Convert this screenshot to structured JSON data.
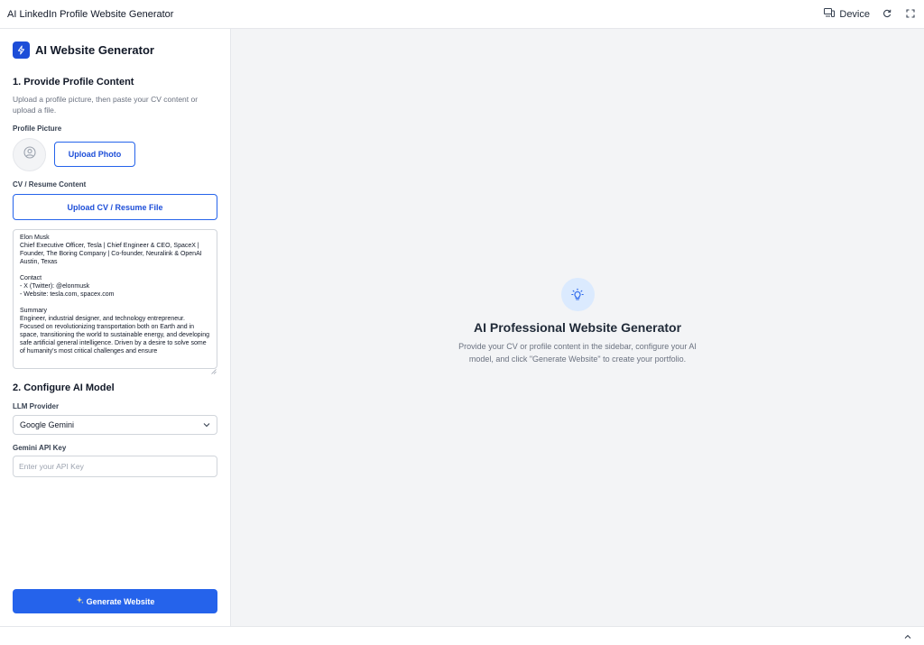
{
  "window": {
    "title": "AI LinkedIn Profile Website Generator",
    "device_label": "Device",
    "icons": {
      "device": "device-icon",
      "refresh": "refresh-icon",
      "fullscreen": "fullscreen-icon",
      "collapse": "chevron-up-icon"
    }
  },
  "sidebar": {
    "brand": "AI Website Generator",
    "step1": {
      "heading": "1. Provide Profile Content",
      "help": "Upload a profile picture, then paste your CV content or upload a file.",
      "profile_label": "Profile Picture",
      "upload_photo": "Upload Photo",
      "cv_label": "CV / Resume Content",
      "upload_cv": "Upload CV / Resume File",
      "cv_text": "Elon Musk\nChief Executive Officer, Tesla | Chief Engineer & CEO, SpaceX | Founder, The Boring Company | Co-founder, Neuralink & OpenAI\nAustin, Texas\n\nContact\n- X (Twitter): @elonmusk\n- Website: tesla.com, spacex.com\n\nSummary\nEngineer, industrial designer, and technology entrepreneur. Focused on revolutionizing transportation both on Earth and in space, transitioning the world to sustainable energy, and developing safe artificial general intelligence. Driven by a desire to solve some of humanity's most critical challenges and ensure"
    },
    "step2": {
      "heading": "2. Configure AI Model",
      "provider_label": "LLM Provider",
      "provider_value": "Google Gemini",
      "api_key_label": "Gemini API Key",
      "api_key_placeholder": "Enter your API Key"
    },
    "generate_label": "Generate Website",
    "generate_icon": "sparkles-icon"
  },
  "main": {
    "empty_icon": "lightbulb-icon",
    "empty_title": "AI Professional Website Generator",
    "empty_desc": "Provide your CV or profile content in the sidebar, configure your AI model, and click \"Generate Website\" to create your portfolio."
  },
  "colors": {
    "accent": "#2563eb",
    "accent_light": "#dbeafe",
    "main_bg": "#f3f4f6"
  }
}
